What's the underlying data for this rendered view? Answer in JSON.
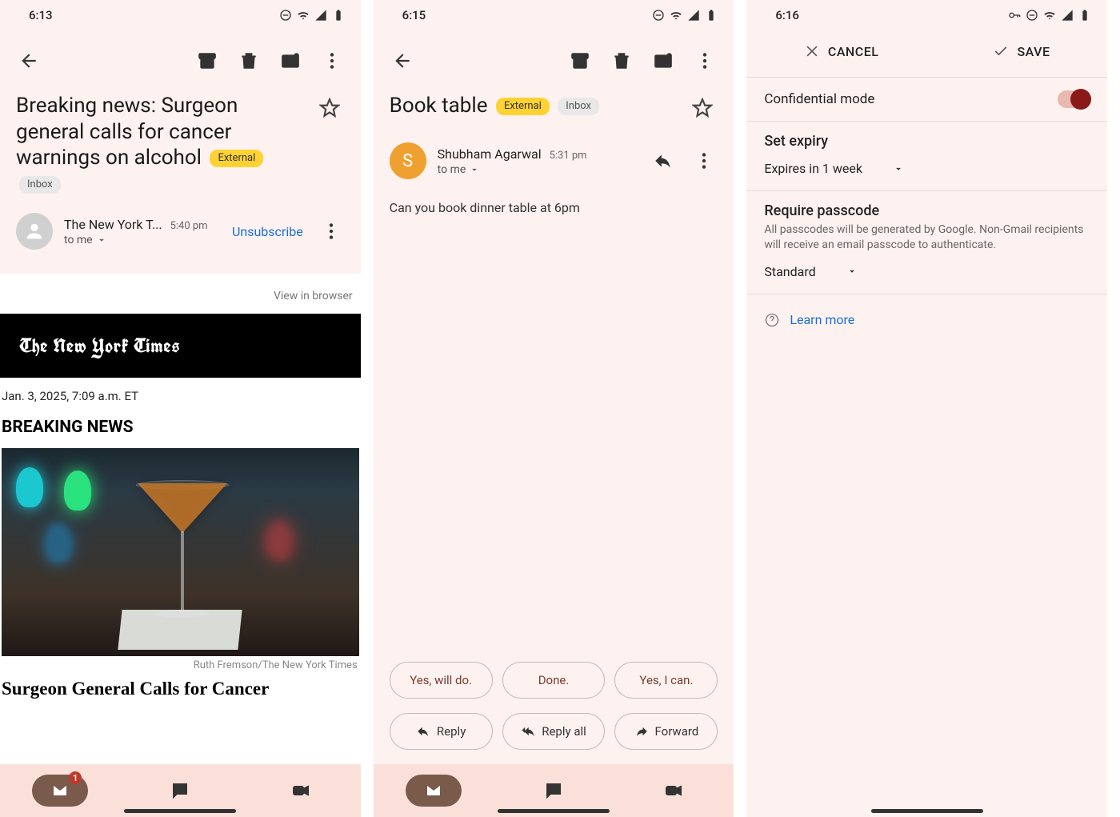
{
  "panel1": {
    "status_time": "6:13",
    "subject": "Breaking news: Surgeon general calls for cancer warnings on alcohol",
    "label_external": "External",
    "label_inbox": "Inbox",
    "sender_name": "The New York T...",
    "sender_time": "5:40 pm",
    "to_line": "to me",
    "unsubscribe": "Unsubscribe",
    "view_in_browser": "View in browser",
    "nyt_logo": "The New York Times",
    "nyt_date": "Jan. 3, 2025, 7:09 a.m. ET",
    "nyt_breaking": "BREAKING NEWS",
    "nyt_credit": "Ruth Fremson/The New York Times",
    "nyt_headline": "Surgeon General Calls for Cancer",
    "mail_badge": "1"
  },
  "panel2": {
    "status_time": "6:15",
    "subject": "Book table",
    "label_external": "External",
    "label_inbox": "Inbox",
    "sender_initial": "S",
    "sender_name": "Shubham Agarwal",
    "sender_time": "5:31 pm",
    "to_line": "to me",
    "body": "Can you book dinner table at 6pm",
    "suggestions": [
      "Yes, will do.",
      "Done.",
      "Yes, I can."
    ],
    "actions": {
      "reply": "Reply",
      "reply_all": "Reply all",
      "forward": "Forward"
    }
  },
  "panel3": {
    "status_time": "6:16",
    "cancel": "CANCEL",
    "save": "SAVE",
    "confidential_label": "Confidential mode",
    "expiry_title": "Set expiry",
    "expiry_value": "Expires in 1 week",
    "passcode_title": "Require passcode",
    "passcode_help": "All passcodes will be generated by Google. Non-Gmail recipients will receive an email passcode to authenticate.",
    "passcode_value": "Standard",
    "learn_more": "Learn more"
  }
}
